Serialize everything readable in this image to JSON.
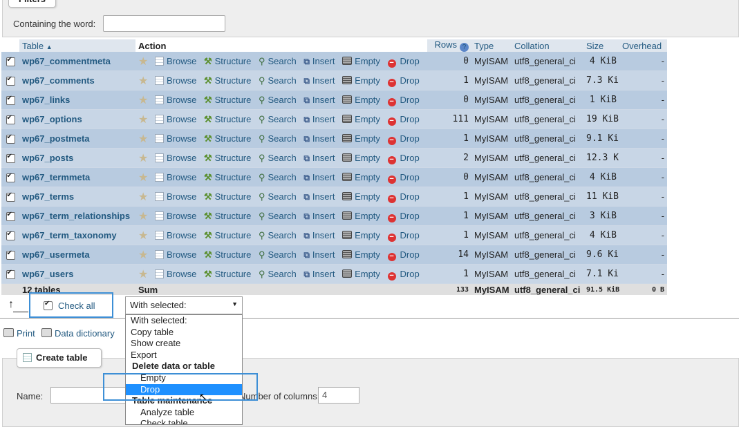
{
  "filters": {
    "legend": "Filters",
    "label": "Containing the word:",
    "value": ""
  },
  "headers": {
    "table": "Table",
    "action": "Action",
    "rows": "Rows",
    "type": "Type",
    "collation": "Collation",
    "size": "Size",
    "overhead": "Overhead"
  },
  "actions": {
    "browse": "Browse",
    "structure": "Structure",
    "search": "Search",
    "insert": "Insert",
    "empty": "Empty",
    "drop": "Drop"
  },
  "tables": [
    {
      "name": "wp67_commentmeta",
      "rows": "0",
      "type": "MyISAM",
      "collation": "utf8_general_ci",
      "size": "4 KiB",
      "overhead": "-"
    },
    {
      "name": "wp67_comments",
      "rows": "1",
      "type": "MyISAM",
      "collation": "utf8_general_ci",
      "size": "7.3 KiB",
      "overhead": "-"
    },
    {
      "name": "wp67_links",
      "rows": "0",
      "type": "MyISAM",
      "collation": "utf8_general_ci",
      "size": "1 KiB",
      "overhead": "-"
    },
    {
      "name": "wp67_options",
      "rows": "111",
      "type": "MyISAM",
      "collation": "utf8_general_ci",
      "size": "19 KiB",
      "overhead": "-"
    },
    {
      "name": "wp67_postmeta",
      "rows": "1",
      "type": "MyISAM",
      "collation": "utf8_general_ci",
      "size": "9.1 KiB",
      "overhead": "-"
    },
    {
      "name": "wp67_posts",
      "rows": "2",
      "type": "MyISAM",
      "collation": "utf8_general_ci",
      "size": "12.3 KiB",
      "overhead": "-"
    },
    {
      "name": "wp67_termmeta",
      "rows": "0",
      "type": "MyISAM",
      "collation": "utf8_general_ci",
      "size": "4 KiB",
      "overhead": "-"
    },
    {
      "name": "wp67_terms",
      "rows": "1",
      "type": "MyISAM",
      "collation": "utf8_general_ci",
      "size": "11 KiB",
      "overhead": "-"
    },
    {
      "name": "wp67_term_relationships",
      "rows": "1",
      "type": "MyISAM",
      "collation": "utf8_general_ci",
      "size": "3 KiB",
      "overhead": "-"
    },
    {
      "name": "wp67_term_taxonomy",
      "rows": "1",
      "type": "MyISAM",
      "collation": "utf8_general_ci",
      "size": "4 KiB",
      "overhead": "-"
    },
    {
      "name": "wp67_usermeta",
      "rows": "14",
      "type": "MyISAM",
      "collation": "utf8_general_ci",
      "size": "9.6 KiB",
      "overhead": "-"
    },
    {
      "name": "wp67_users",
      "rows": "1",
      "type": "MyISAM",
      "collation": "utf8_general_ci",
      "size": "7.1 KiB",
      "overhead": "-"
    }
  ],
  "summary": {
    "label": "12 tables",
    "sum": "Sum",
    "rows": "133",
    "type": "MyISAM",
    "collation": "utf8_general_ci",
    "size": "91.5 KiB",
    "overhead": "0 B"
  },
  "bulk": {
    "check_all": "Check all",
    "with_selected": "With selected:",
    "arrow": "↑"
  },
  "dropdown_options": [
    {
      "label": "With selected:",
      "kind": "option"
    },
    {
      "label": "Copy table",
      "kind": "option"
    },
    {
      "label": "Show create",
      "kind": "option"
    },
    {
      "label": "Export",
      "kind": "option"
    },
    {
      "label": "Delete data or table",
      "kind": "group"
    },
    {
      "label": "Empty",
      "kind": "indent"
    },
    {
      "label": "Drop",
      "kind": "indent-selected"
    },
    {
      "label": "Table maintenance",
      "kind": "group"
    },
    {
      "label": "Analyze table",
      "kind": "indent"
    },
    {
      "label": "Check table",
      "kind": "indent"
    }
  ],
  "links": {
    "print": "Print",
    "data_dictionary": "Data dictionary"
  },
  "create": {
    "legend": "Create table",
    "name_label": "Name:",
    "name_value": "",
    "cols_label": "Number of columns:",
    "cols_value": "4"
  },
  "colors": {
    "row": "#b8cbe0",
    "row_alt": "#c8d6e6",
    "link": "#235a81",
    "highlight": "#3d8fd6",
    "selected": "#1e90ff"
  }
}
